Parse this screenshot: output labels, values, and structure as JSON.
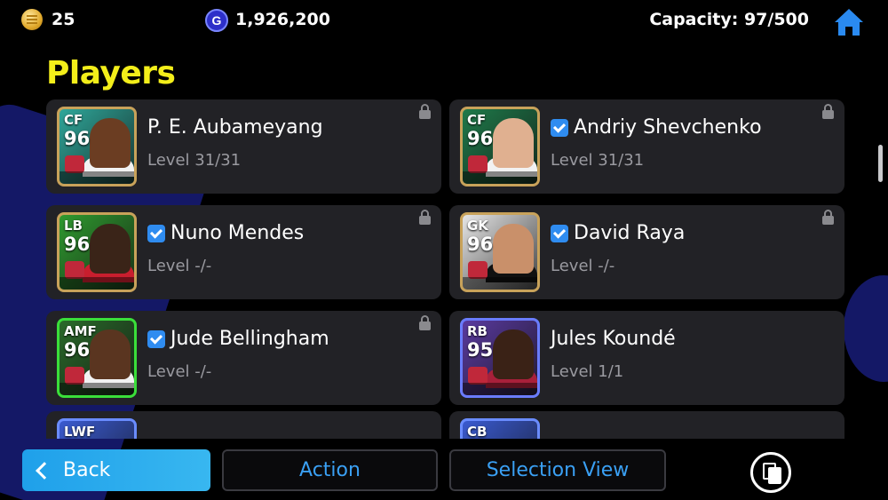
{
  "topbar": {
    "coins": "25",
    "gp": "1,926,200",
    "gp_icon_letter": "G",
    "capacity": "Capacity: 97/500"
  },
  "page_title": "Players",
  "players": [
    {
      "position": "CF",
      "rating": "96",
      "name": "P. E. Aubameyang",
      "level": "Level 31/31",
      "verified": false,
      "card_border": "#c8a25a",
      "card_bg": "#2fa79a"
    },
    {
      "position": "CF",
      "rating": "96",
      "name": "Andriy Shevchenko",
      "level": "Level 31/31",
      "verified": true,
      "card_border": "#c8a25a",
      "card_bg": "#1f7a4a"
    },
    {
      "position": "LB",
      "rating": "96",
      "name": "Nuno Mendes",
      "level": "Level -/-",
      "verified": true,
      "card_border": "#c8a25a",
      "card_bg": "#2f9a2f"
    },
    {
      "position": "GK",
      "rating": "96",
      "name": "David Raya",
      "level": "Level -/-",
      "verified": true,
      "card_border": "#c8a25a",
      "card_bg": "#e6e6e6"
    },
    {
      "position": "AMF",
      "rating": "96",
      "name": "Jude Bellingham",
      "level": "Level -/-",
      "verified": true,
      "card_border": "#3adf3a",
      "card_bg": "#2a6a2a"
    },
    {
      "position": "RB",
      "rating": "95",
      "name": "Jules Koundé",
      "level": "Level 1/1",
      "verified": false,
      "card_border": "#6a7cff",
      "card_bg": "#5a3aa0"
    }
  ],
  "partial_players": [
    {
      "position": "LWF"
    },
    {
      "position": "CB"
    }
  ],
  "bottom": {
    "back_label": "Back",
    "action_label": "Action",
    "selection_label": "Selection View"
  },
  "colors": {
    "title": "#f3ee1a",
    "accent": "#3aa0f4",
    "card": "#222226",
    "check": "#2f8cf0"
  }
}
